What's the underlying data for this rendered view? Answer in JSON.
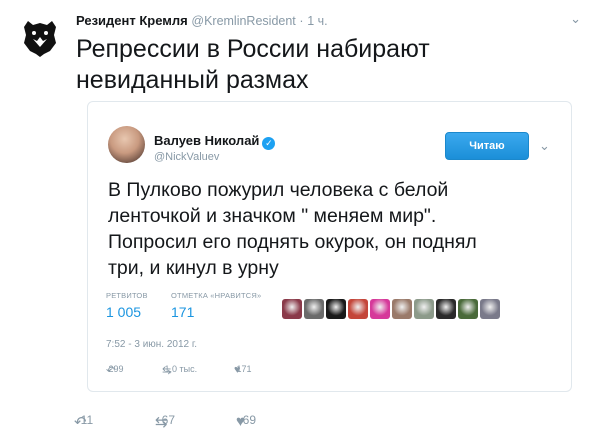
{
  "tweet": {
    "author_name": "Резидент Кремля",
    "author_handle": "@KremlinResident",
    "separator": "·",
    "time": "1 ч.",
    "text_line1": "Репрессии в России набирают",
    "text_line2": "невиданный размах",
    "avatar": "bear-logo",
    "actions": {
      "reply_count": "11",
      "retweet_count": "67",
      "like_count": "69"
    }
  },
  "quote": {
    "author_name": "Валуев Николай",
    "author_handle": "@NickValuev",
    "follow_label": "Читаю",
    "text_lines": [
      "В Пулково пожурил человека с белой",
      "ленточкой и значком \" меняем мир\".",
      "Попросил его поднять окурок, он  поднял",
      "три, и кинул в урну"
    ],
    "retweets_label": "РЕТВИТОВ",
    "retweets_value": "1 005",
    "likes_label": "ОТМЕТКА «НРАВИТСЯ»",
    "likes_value": "171",
    "date": "7:52 - 3 июн. 2012 г.",
    "actions": {
      "reply_count": "299",
      "retweet_count": "1,0 тыс.",
      "like_count": "171"
    },
    "liker_colors": [
      "#8a3a4a",
      "#6b6b6b",
      "#1a1a1a",
      "#c4463a",
      "#d6399a",
      "#9a7a6a",
      "#8c9a8a",
      "#2a2a2a",
      "#4a6a3a",
      "#7a7a8a"
    ]
  },
  "icons": {
    "reply": "reply-icon",
    "retweet": "retweet-icon",
    "like": "heart-icon",
    "verified": "verified-badge-icon",
    "caret": "chevron-down-icon"
  },
  "colors": {
    "accent": "#1da1f2",
    "muted": "#8899a6",
    "text": "#14171a"
  }
}
